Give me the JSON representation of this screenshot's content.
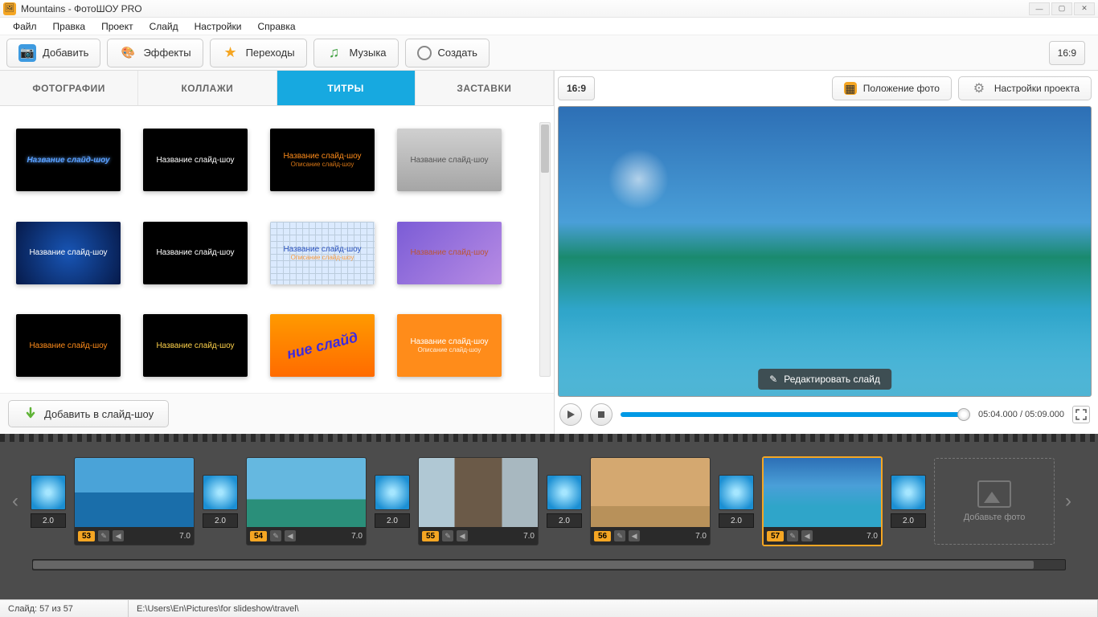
{
  "window": {
    "title": "Mountains - ФотоШОУ PRO"
  },
  "menu": {
    "items": [
      "Файл",
      "Правка",
      "Проект",
      "Слайд",
      "Настройки",
      "Справка"
    ]
  },
  "toolbar": {
    "add": "Добавить",
    "effects": "Эффекты",
    "transitions": "Переходы",
    "music": "Музыка",
    "create": "Создать",
    "aspect": "16:9",
    "photo_position": "Положение фото",
    "project_settings": "Настройки проекта"
  },
  "tabs": {
    "photos": "ФОТОГРАФИИ",
    "collages": "КОЛЛАЖИ",
    "titles": "ТИТРЫ",
    "intros": "ЗАСТАВКИ"
  },
  "titles_grid": [
    {
      "variant": "t-black glow",
      "line1": "Название слайд-шоу",
      "line2": ""
    },
    {
      "variant": "t-black",
      "line1": "Название слайд-шоу",
      "line2": ""
    },
    {
      "variant": "t-black",
      "line1": "Название слайд-шоу",
      "line2": "Описание слайд-шоу",
      "c1": "#ff8c1a",
      "c2": "#ff8c1a"
    },
    {
      "variant": "t-gray",
      "line1": "Название слайд-шоу",
      "line2": ""
    },
    {
      "variant": "t-blue",
      "line1": "Название слайд-шоу",
      "line2": ""
    },
    {
      "variant": "t-black",
      "line1": "Название слайд-шоу",
      "line2": ""
    },
    {
      "variant": "t-grid",
      "line1": "Название слайд-шоу",
      "line2": "Описание слайд-шоу",
      "c2": "#ff8c1a"
    },
    {
      "variant": "t-purple",
      "line1": "Название слайд-шоу",
      "line2": ""
    },
    {
      "variant": "t-black",
      "line1": "Название слайд-шоу",
      "line2": "",
      "c1": "#ff8c1a"
    },
    {
      "variant": "t-black",
      "line1": "Название слайд-шоу",
      "line2": "",
      "c1": "#ffd24a"
    },
    {
      "variant": "t-gold",
      "skew": "ние слайд",
      "line1": "",
      "line2": ""
    },
    {
      "variant": "t-orange",
      "line1": "Название слайд-шоу",
      "line2": "Описание слайд-шоу"
    }
  ],
  "add_to_slideshow": "Добавить в слайд-шоу",
  "preview": {
    "edit_slide": "Редактировать слайд"
  },
  "playback": {
    "time": "05:04.000 / 05:09.000"
  },
  "timeline": {
    "slides": [
      {
        "num": "53",
        "trans": "2.0",
        "dur": "7.0",
        "img": "si-1"
      },
      {
        "num": "54",
        "trans": "2.0",
        "dur": "7.0",
        "img": "si-2"
      },
      {
        "num": "55",
        "trans": "2.0",
        "dur": "7.0",
        "img": "si-3"
      },
      {
        "num": "56",
        "trans": "2.0",
        "dur": "7.0",
        "img": "si-4"
      },
      {
        "num": "57",
        "trans": "2.0",
        "dur": "7.0",
        "img": "si-5",
        "selected": true
      }
    ],
    "last_trans": "2.0",
    "add_photo": "Добавьте фото"
  },
  "status": {
    "slide_info": "Слайд: 57 из 57",
    "path": "E:\\Users\\En\\Pictures\\for slideshow\\travel\\"
  }
}
